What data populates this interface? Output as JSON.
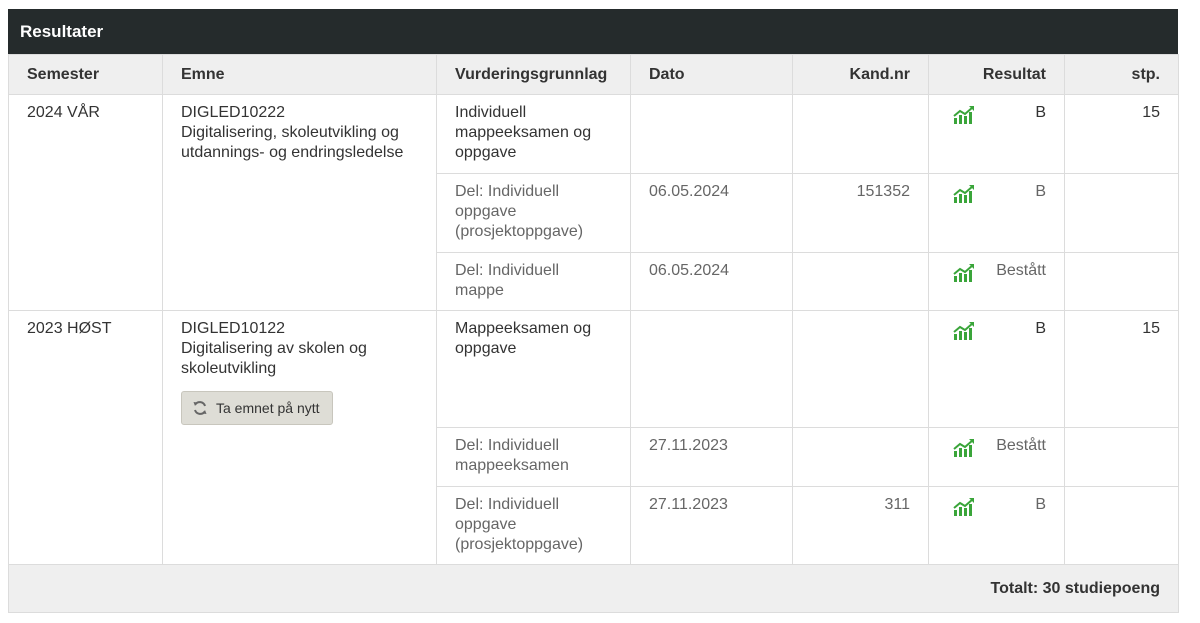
{
  "panel": {
    "title": "Resultater"
  },
  "headers": [
    "Semester",
    "Emne",
    "Vurderingsgrunnlag",
    "Dato",
    "Kand.nr",
    "Resultat",
    "stp."
  ],
  "groups": [
    {
      "semester": "2024 VÅR",
      "course_code": "DIGLED10222",
      "course_name": "Digitalisering, skoleutvikling og utdannings- og endringsledelse",
      "rows": [
        {
          "assessment": "Individuell mappeeksamen og oppgave",
          "date": "",
          "candidate": "",
          "result": "B",
          "credits": "15"
        },
        {
          "assessment": "Del: Individuell oppgave (prosjektoppgave)",
          "date": "06.05.2024",
          "candidate": "151352",
          "result": "B",
          "credits": ""
        },
        {
          "assessment": "Del: Individuell mappe",
          "date": "06.05.2024",
          "candidate": "",
          "result": "Bestått",
          "credits": ""
        }
      ]
    },
    {
      "semester": "2023 HØST",
      "course_code": "DIGLED10122",
      "course_name": "Digitalisering av skolen og skoleutvikling",
      "retake_label": "Ta emnet på nytt",
      "rows": [
        {
          "assessment": "Mappeeksamen og oppgave",
          "date": "",
          "candidate": "",
          "result": "B",
          "credits": "15"
        },
        {
          "assessment": "Del: Individuell mappeeksamen",
          "date": "27.11.2023",
          "candidate": "",
          "result": "Bestått",
          "credits": ""
        },
        {
          "assessment": "Del: Individuell oppgave (prosjektoppgave)",
          "date": "27.11.2023",
          "candidate": "311",
          "result": "B",
          "credits": ""
        }
      ]
    }
  ],
  "total": "Totalt: 30 studiepoeng",
  "icons": {
    "result_icon": "bar-chart-trend-icon",
    "retake_icon": "refresh-icon"
  },
  "colors": {
    "header_bg": "#252b2c",
    "icon_green": "#3aa53a"
  }
}
